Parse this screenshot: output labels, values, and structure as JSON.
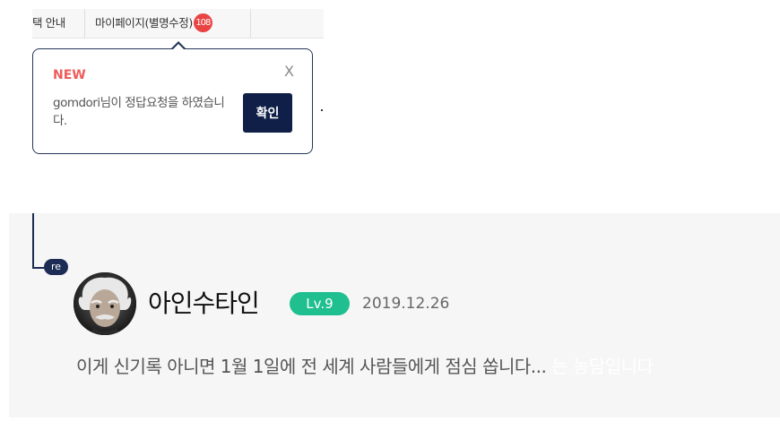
{
  "topbar": {
    "guide_label": "택 안내",
    "mypage_label": "마이페이지(별명수정)",
    "mypage_badge": "108"
  },
  "popup": {
    "new_label": "NEW",
    "close_label": "X",
    "message": "gomdori님이 정답요청을 하였습니다.",
    "confirm_label": "확인"
  },
  "reply": {
    "re_tag": "re",
    "author": "아인수타인",
    "level": "Lv.9",
    "date": "2019.12.26",
    "text_visible": "이게 신기록 아니면 1월 1일에 전 세계 사람들에게 점심 쏩니다...",
    "text_faded": " 는 농담입니다"
  },
  "colors": {
    "navy": "#1c2c55",
    "new_red": "#ef5a5a",
    "level_green": "#1fbf8f",
    "badge_red": "#e94444"
  }
}
